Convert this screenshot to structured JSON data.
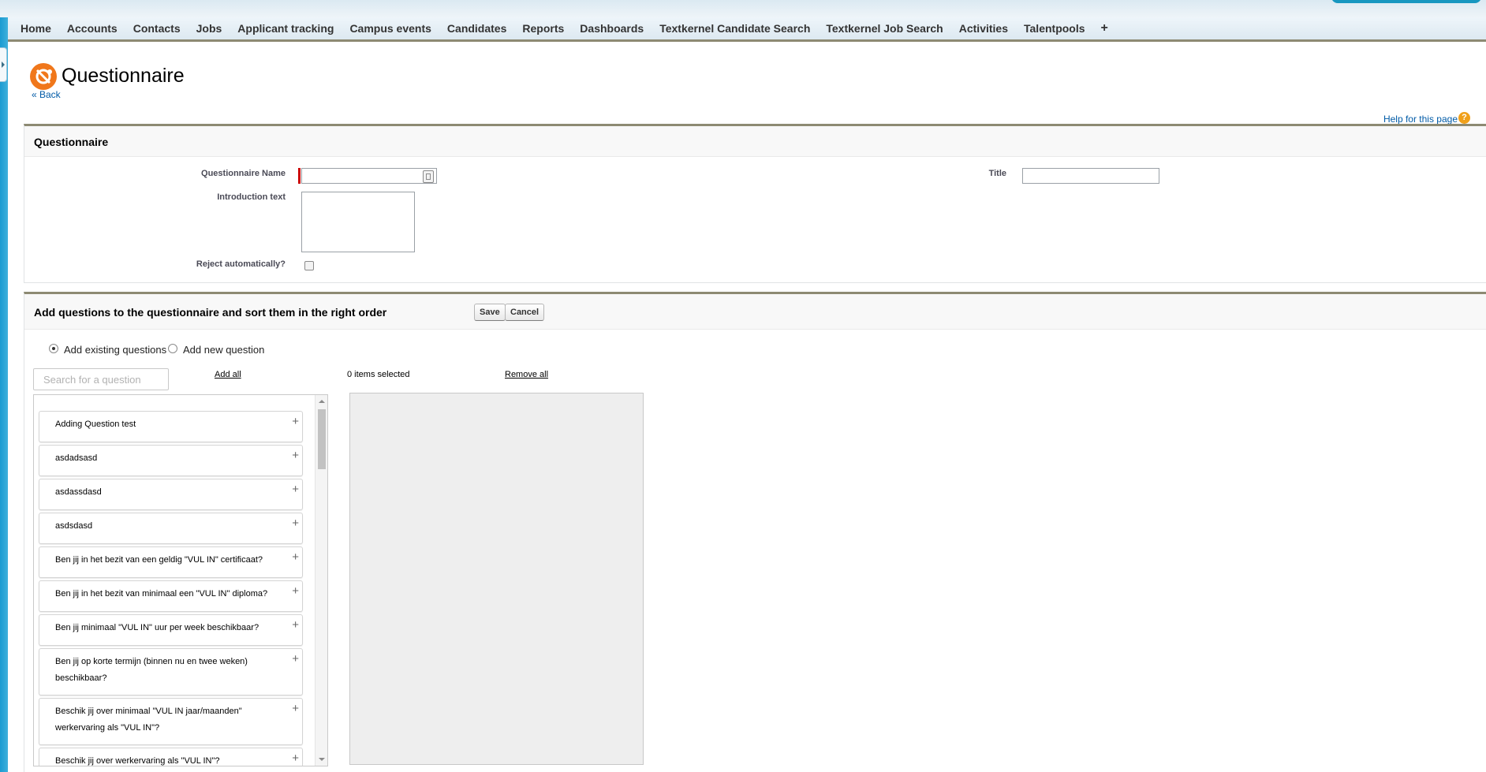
{
  "nav": {
    "tabs": [
      "Home",
      "Accounts",
      "Contacts",
      "Jobs",
      "Applicant tracking",
      "Campus events",
      "Candidates",
      "Reports",
      "Dashboards",
      "Textkernel Candidate Search",
      "Textkernel Job Search",
      "Activities",
      "Talentpools"
    ],
    "add_tab": "+"
  },
  "header": {
    "title": "Questionnaire",
    "back_link": "« Back",
    "help_link": "Help for this page",
    "help_icon": "?"
  },
  "details": {
    "section_title": "Questionnaire",
    "name_label": "Questionnaire Name",
    "name_value": "",
    "title_label": "Title",
    "title_value": "",
    "intro_label": "Introduction text",
    "reject_label": "Reject automatically?",
    "reject_checked": false
  },
  "questions": {
    "section_title": "Add questions to the questionnaire and sort them in the right order",
    "save_label": "Save",
    "cancel_label": "Cancel",
    "mode_existing": "Add existing questions",
    "mode_new": "Add new question",
    "mode_selected": "existing",
    "search_placeholder": "Search for a question",
    "add_all": "Add all",
    "selected_count": "0 items selected",
    "remove_all": "Remove all",
    "items": [
      "Adding Question test",
      "asdadsasd",
      "asdassdasd",
      "asdsdasd",
      "Ben jij in het bezit van een geldig \"VUL IN\" certificaat?",
      "Ben jij in het bezit van minimaal een \"VUL IN\" diploma?",
      "Ben jij minimaal \"VUL IN\" uur per week beschikbaar?",
      "Ben jij op korte termijn (binnen nu en twee weken) beschikbaar?",
      "Beschik jij over minimaal \"VUL IN jaar/maanden\" werkervaring als \"VUL IN\"?",
      "Beschik jij over werkervaring als \"VUL IN\"?"
    ]
  }
}
